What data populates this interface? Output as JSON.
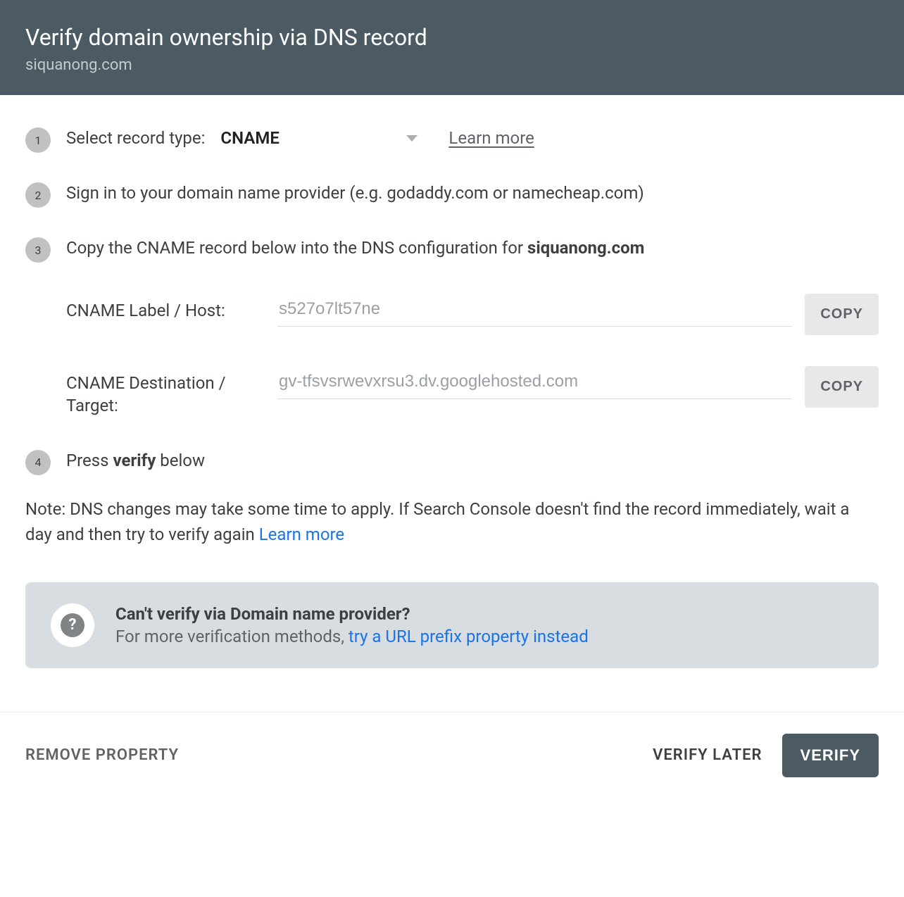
{
  "header": {
    "title": "Verify domain ownership via DNS record",
    "subtitle": "siquanong.com"
  },
  "step1": {
    "num": "1",
    "label": "Select record type:",
    "selected": "CNAME",
    "learn": "Learn more"
  },
  "step2": {
    "num": "2",
    "text": "Sign in to your domain name provider (e.g. godaddy.com or namecheap.com)"
  },
  "step3": {
    "num": "3",
    "prefix": "Copy the CNAME record below into the DNS configuration for ",
    "domain": "siquanong.com"
  },
  "cname": {
    "label1": "CNAME Label / Host:",
    "value1": "s527o7lt57ne",
    "label2": "CNAME Destination / Target:",
    "value2": "gv-tfsvsrwevxrsu3.dv.googlehosted.com",
    "copy": "COPY"
  },
  "step4": {
    "num": "4",
    "prefix": "Press ",
    "bold": "verify",
    "suffix": " below"
  },
  "note": {
    "text": "Note: DNS changes may take some time to apply. If Search Console doesn't find the record immediately, wait a day and then try to verify again ",
    "link": "Learn more"
  },
  "help": {
    "title": "Can't verify via Domain name provider?",
    "sub": "For more verification methods, ",
    "link": "try a URL prefix property instead"
  },
  "footer": {
    "remove": "REMOVE PROPERTY",
    "later": "VERIFY LATER",
    "verify": "VERIFY"
  }
}
